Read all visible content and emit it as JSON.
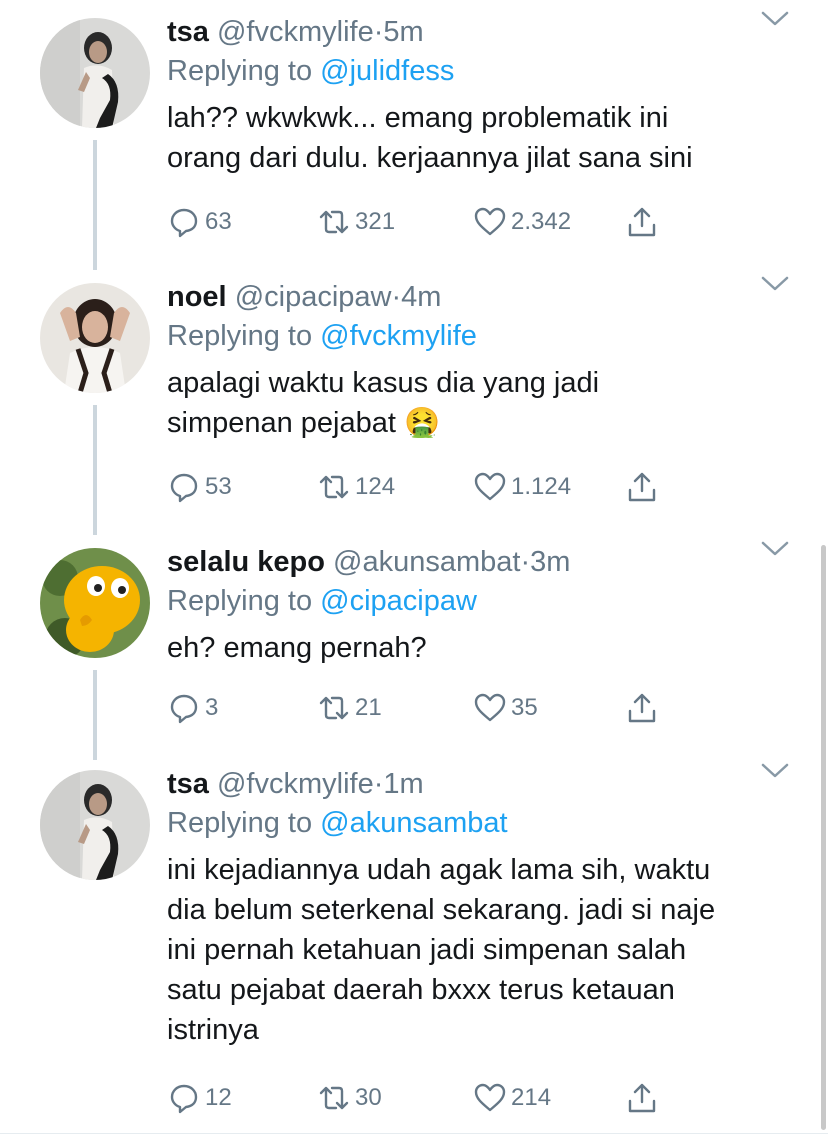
{
  "tweets": [
    {
      "name": "tsa",
      "handle": "@fvckmylife",
      "time": "5m",
      "replying_prefix": "Replying to ",
      "replying_to": "@julidfess",
      "text_lines": [
        "lah?? wkwkwk... emang problematik ini",
        "orang dari dulu. kerjaannya jilat sana sini"
      ],
      "replies": "63",
      "retweets": "321",
      "likes": "2.342"
    },
    {
      "name": "noel",
      "handle": "@cipacipaw",
      "time": "4m",
      "replying_prefix": "Replying to ",
      "replying_to": "@fvckmylife",
      "text_lines": [
        "apalagi waktu kasus dia yang jadi",
        "simpenan pejabat 🤮"
      ],
      "replies": "53",
      "retweets": "124",
      "likes": "1.124"
    },
    {
      "name": "selalu kepo",
      "handle": "@akunsambat",
      "time": "3m",
      "replying_prefix": "Replying to ",
      "replying_to": "@cipacipaw",
      "text_lines": [
        "eh? emang pernah?"
      ],
      "replies": "3",
      "retweets": "21",
      "likes": "35"
    },
    {
      "name": "tsa",
      "handle": "@fvckmylife",
      "time": "1m",
      "replying_prefix": "Replying to ",
      "replying_to": "@akunsambat",
      "text_lines": [
        "ini kejadiannya udah agak lama sih, waktu",
        "dia belum seterkenal sekarang. jadi si naje",
        "ini pernah ketahuan jadi simpenan salah",
        "satu pejabat daerah bxxx terus ketauan",
        "istrinya"
      ],
      "replies": "12",
      "retweets": "30",
      "likes": "214"
    }
  ],
  "separator": "·",
  "icons": {
    "reply": "reply-icon",
    "retweet": "retweet-icon",
    "like": "heart-icon",
    "share": "share-icon",
    "more": "chevron-down-icon"
  },
  "colors": {
    "accent": "#1da1f2",
    "secondary_text": "#657786",
    "thread_line": "#ccd6dd"
  }
}
